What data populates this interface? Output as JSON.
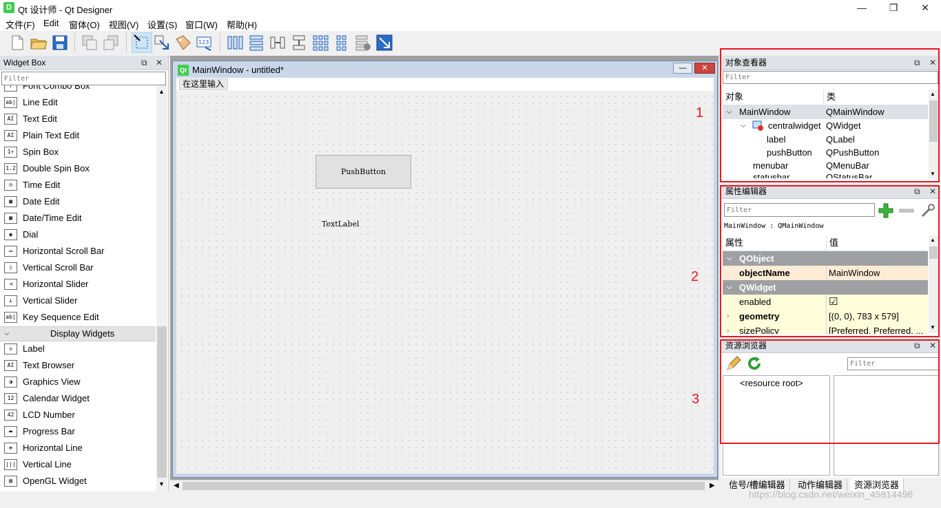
{
  "window": {
    "title": "Qt 设计师 - Qt Designer",
    "icon_letter": "D",
    "minimize": "—",
    "restore": "❐",
    "close": "✕"
  },
  "menubar": [
    "文件(F)",
    "Edit",
    "窗体(O)",
    "视图(V)",
    "设置(S)",
    "窗口(W)",
    "帮助(H)"
  ],
  "widget_box": {
    "title": "Widget Box",
    "filter_placeholder": "Filter",
    "items": [
      {
        "label": "Font Combo Box",
        "icon": "font-combo-icon",
        "glyph": "f"
      },
      {
        "label": "Line Edit",
        "icon": "line-edit-icon",
        "glyph": "ab|"
      },
      {
        "label": "Text Edit",
        "icon": "text-edit-icon",
        "glyph": "AI"
      },
      {
        "label": "Plain Text Edit",
        "icon": "plain-text-edit-icon",
        "glyph": "AI"
      },
      {
        "label": "Spin Box",
        "icon": "spin-box-icon",
        "glyph": "1÷"
      },
      {
        "label": "Double Spin Box",
        "icon": "double-spin-box-icon",
        "glyph": "1.2"
      },
      {
        "label": "Time Edit",
        "icon": "clock-icon",
        "glyph": "◷"
      },
      {
        "label": "Date Edit",
        "icon": "calendar-icon",
        "glyph": "▦"
      },
      {
        "label": "Date/Time Edit",
        "icon": "datetime-icon",
        "glyph": "▦"
      },
      {
        "label": "Dial",
        "icon": "dial-icon",
        "glyph": "◉"
      },
      {
        "label": "Horizontal Scroll Bar",
        "icon": "hscrollbar-icon",
        "glyph": "▭"
      },
      {
        "label": "Vertical Scroll Bar",
        "icon": "vscrollbar-icon",
        "glyph": "▯"
      },
      {
        "label": "Horizontal Slider",
        "icon": "hslider-icon",
        "glyph": "⊣"
      },
      {
        "label": "Vertical Slider",
        "icon": "vslider-icon",
        "glyph": "⊥"
      },
      {
        "label": "Key Sequence Edit",
        "icon": "key-sequence-icon",
        "glyph": "ab|"
      }
    ],
    "category": "Display Widgets",
    "display_items": [
      {
        "label": "Label",
        "icon": "label-tag-icon",
        "glyph": "◇"
      },
      {
        "label": "Text Browser",
        "icon": "text-browser-icon",
        "glyph": "AI"
      },
      {
        "label": "Graphics View",
        "icon": "graphics-view-icon",
        "glyph": "◑"
      },
      {
        "label": "Calendar Widget",
        "icon": "calendar-widget-icon",
        "glyph": "12"
      },
      {
        "label": "LCD Number",
        "icon": "lcd-number-icon",
        "glyph": "42"
      },
      {
        "label": "Progress Bar",
        "icon": "progress-bar-icon",
        "glyph": "▬"
      },
      {
        "label": "Horizontal Line",
        "icon": "horizontal-line-icon",
        "glyph": "≡"
      },
      {
        "label": "Vertical Line",
        "icon": "vertical-line-icon",
        "glyph": "|||"
      },
      {
        "label": "OpenGL Widget",
        "icon": "opengl-widget-icon",
        "glyph": "▨"
      }
    ]
  },
  "form": {
    "title": "MainWindow - untitled*",
    "qt_badge": "Qt",
    "type_here": "在这里输入",
    "push_button": "PushButton",
    "text_label": "TextLabel"
  },
  "object_inspector": {
    "title": "对象查看器",
    "filter_placeholder": "Filter",
    "columns": [
      "对象",
      "类"
    ],
    "rows": [
      {
        "object": "MainWindow",
        "class": "QMainWindow"
      },
      {
        "object": "centralwidget",
        "class": "QWidget"
      },
      {
        "object": "label",
        "class": "QLabel"
      },
      {
        "object": "pushButton",
        "class": "QPushButton"
      },
      {
        "object": "menubar",
        "class": "QMenuBar"
      },
      {
        "object": "statusbar",
        "class": "QStatusBar"
      }
    ]
  },
  "property_editor": {
    "title": "属性编辑器",
    "filter_placeholder": "Filter",
    "context": "MainWindow : QMainWindow",
    "columns": [
      "属性",
      "值"
    ],
    "groups": [
      "QObject",
      "QWidget"
    ],
    "rows": [
      {
        "name": "objectName",
        "value": "MainWindow"
      },
      {
        "name": "enabled",
        "value": "☑"
      },
      {
        "name": "geometry",
        "value": "[(0, 0), 783 x 579]"
      },
      {
        "name": "sizePolicy",
        "value": "[Preferred, Preferred, ..."
      }
    ]
  },
  "resource_browser": {
    "title": "资源浏览器",
    "filter_placeholder": "Filter",
    "root": "<resource root>"
  },
  "bottom_tabs": [
    "信号/槽编辑器",
    "动作编辑器",
    "资源浏览器"
  ],
  "annotations": [
    "1",
    "2",
    "3"
  ],
  "watermark": "https://blog.csdn.net/weixin_45814496",
  "colors": {
    "annotation_red": "#e8171f",
    "qt_green": "#41cd52",
    "selected_row": "#dde0e4",
    "prop_highlight": "#fdebd6",
    "prop_yellow": "#fefcd9"
  }
}
